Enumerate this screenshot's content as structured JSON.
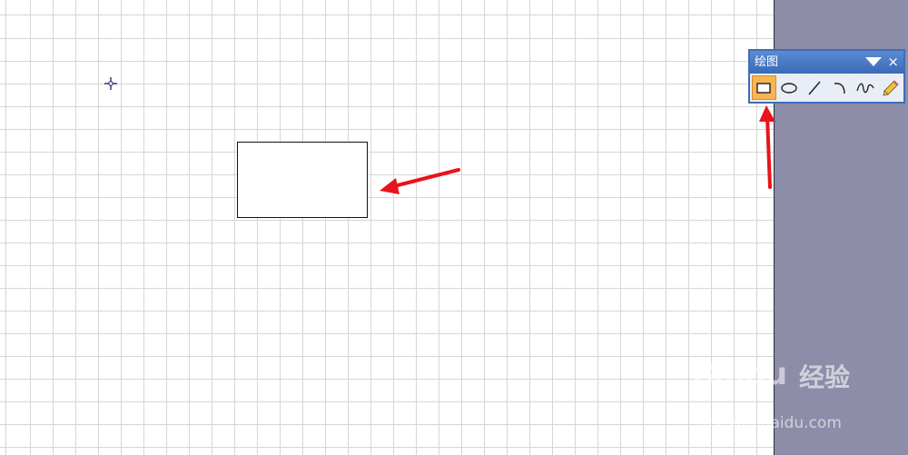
{
  "toolbar": {
    "title": "绘图",
    "close_label": "×",
    "tools": [
      {
        "id": "rectangle",
        "icon": "rectangle-icon",
        "selected": true
      },
      {
        "id": "ellipse",
        "icon": "ellipse-icon",
        "selected": false
      },
      {
        "id": "line",
        "icon": "line-icon",
        "selected": false
      },
      {
        "id": "arc",
        "icon": "arc-icon",
        "selected": false
      },
      {
        "id": "freeform",
        "icon": "freeform-icon",
        "selected": false
      },
      {
        "id": "pencil",
        "icon": "pencil-icon",
        "selected": false
      }
    ]
  },
  "watermark": {
    "brand": "Baidu",
    "product": "经验",
    "url": "jingyan.baidu.com"
  },
  "colors": {
    "accent_arrow": "#e8141b",
    "toolbar_titlebar": "#3a6ab8",
    "selected_tool": "#f7b552",
    "outside_page": "#8d8da9"
  }
}
